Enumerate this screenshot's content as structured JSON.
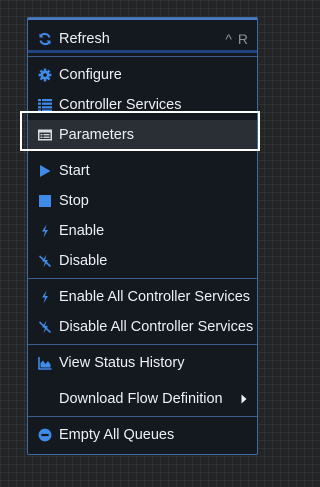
{
  "menu": {
    "items": [
      {
        "label": "Refresh",
        "icon": "refresh-icon",
        "shortcut": "^ R"
      },
      {
        "label": "Configure",
        "icon": "gear-icon"
      },
      {
        "label": "Controller Services",
        "icon": "list-icon"
      },
      {
        "label": "Parameters",
        "icon": "parameters-icon"
      },
      {
        "label": "Start",
        "icon": "play-icon"
      },
      {
        "label": "Stop",
        "icon": "stop-icon"
      },
      {
        "label": "Enable",
        "icon": "lightning-icon"
      },
      {
        "label": "Disable",
        "icon": "lightning-slash-icon"
      },
      {
        "label": "Enable All Controller Services",
        "icon": "lightning-icon"
      },
      {
        "label": "Disable All Controller Services",
        "icon": "lightning-slash-icon"
      },
      {
        "label": "View Status History",
        "icon": "area-chart-icon"
      },
      {
        "label": "Download Flow Definition",
        "icon": "chevron-right-icon"
      },
      {
        "label": "Empty All Queues",
        "icon": "minus-circle-icon"
      }
    ]
  },
  "colors": {
    "icon_blue": "#3f8be8",
    "menu_border": "#3d6ba8",
    "highlight": "#2a2e35",
    "selection_outline": "#ffffff"
  }
}
